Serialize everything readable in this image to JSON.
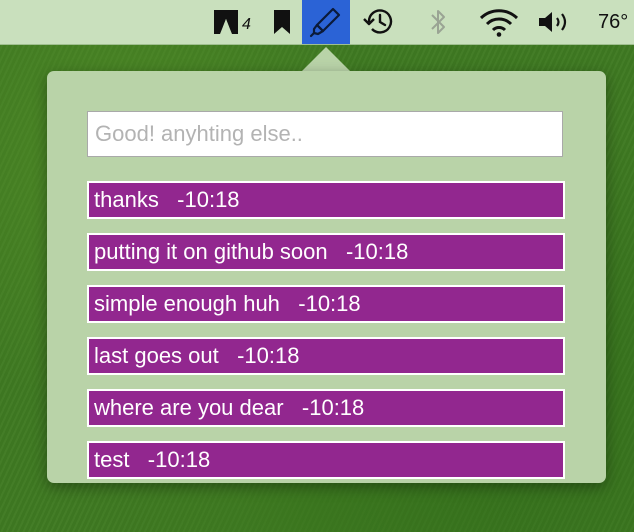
{
  "menubar": {
    "items": [
      {
        "name": "adobe-icon",
        "badge": "4"
      },
      {
        "name": "bookmark-icon"
      },
      {
        "name": "marker-pen-icon",
        "active": true
      },
      {
        "name": "time-machine-icon"
      },
      {
        "name": "bluetooth-icon"
      },
      {
        "name": "wifi-icon"
      },
      {
        "name": "volume-icon"
      }
    ],
    "battery_text": "76°",
    "active_color": "#2b63d6"
  },
  "popover": {
    "input": {
      "value": "",
      "placeholder": "Good! anyhting else.."
    },
    "messages": [
      {
        "text": "thanks   -10:18"
      },
      {
        "text": "putting it on github soon   -10:18"
      },
      {
        "text": "simple enough huh   -10:18"
      },
      {
        "text": "last goes out   -10:18"
      },
      {
        "text": "where are you dear   -10:18"
      },
      {
        "text": "test   -10:18"
      }
    ],
    "message_color": "#92278f",
    "background_color": "#b9d3a8"
  }
}
